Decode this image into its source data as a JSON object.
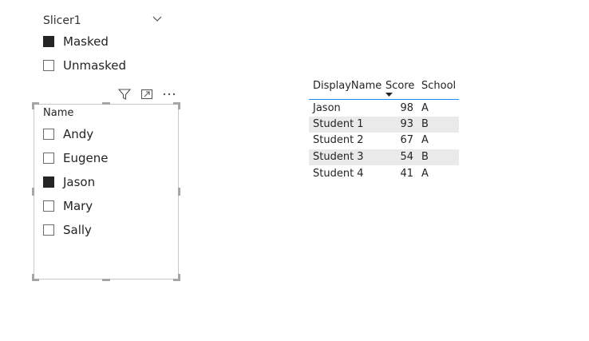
{
  "slicer1": {
    "title": "Slicer1",
    "options": [
      {
        "label": "Masked",
        "checked": true
      },
      {
        "label": "Unmasked",
        "checked": false
      }
    ]
  },
  "slicer2": {
    "header": "Name",
    "options": [
      {
        "label": "Andy",
        "checked": false
      },
      {
        "label": "Eugene",
        "checked": false
      },
      {
        "label": "Jason",
        "checked": true
      },
      {
        "label": "Mary",
        "checked": false
      },
      {
        "label": "Sally",
        "checked": false
      }
    ]
  },
  "toolbar": {
    "icons": [
      "filter-icon",
      "focus-mode-icon",
      "more-options-icon"
    ]
  },
  "table": {
    "columns": [
      "DisplayName",
      "Score",
      "School"
    ],
    "sort_column": "Score",
    "rows": [
      {
        "name": "Jason",
        "score": "98",
        "school": "A"
      },
      {
        "name": "Student 1",
        "score": "93",
        "school": "B"
      },
      {
        "name": "Student 2",
        "score": "67",
        "school": "A"
      },
      {
        "name": "Student 3",
        "score": "54",
        "school": "B"
      },
      {
        "name": "Student 4",
        "score": "41",
        "school": "A"
      }
    ]
  },
  "colors": {
    "accent": "#118dff",
    "checked_fill": "#252423",
    "alt_row": "#eaeaea"
  }
}
